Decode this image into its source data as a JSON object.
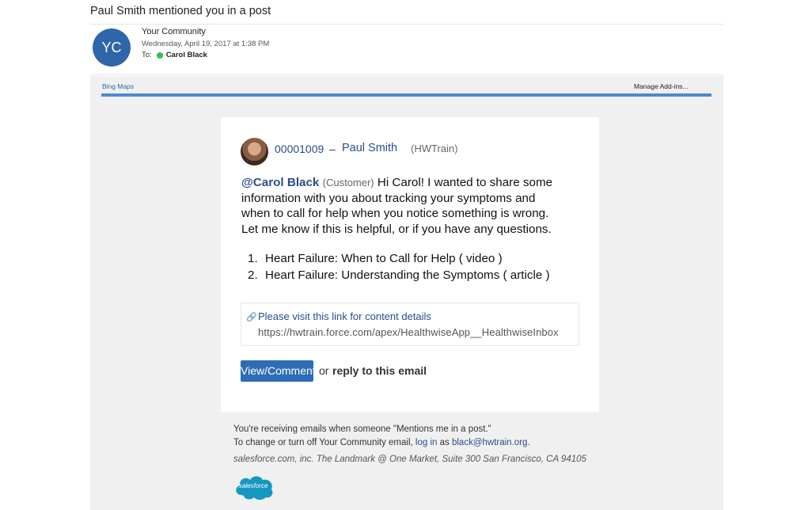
{
  "email": {
    "subject": "Paul Smith mentioned you in a post",
    "avatar_initials": "YC",
    "sender": "Your Community",
    "date": "Wednesday, April 19, 2017 at 1:38 PM",
    "to_label": "To:",
    "recipient": "Carol Black"
  },
  "addin_bar": {
    "left_link": "Bing Maps",
    "right_link": "Manage Add-ins..."
  },
  "post": {
    "case_number": "00001009",
    "separator": "–",
    "author": "Paul Smith",
    "author_org": "(HWTrain)",
    "mention": "@Carol Black",
    "mention_role": "(Customer)",
    "line1_rest": "Hi Carol! I wanted to share some",
    "line2": "information with you about tracking your symptoms and",
    "line3": "when to call for help when you notice something is wrong.",
    "line4": "Let me know if this is helpful, or if you have any questions.",
    "resources": [
      {
        "num": "1.",
        "label": "Heart Failure: When to Call for Help ( video )"
      },
      {
        "num": "2.",
        "label": "Heart Failure: Understanding the Symptoms ( article )"
      }
    ],
    "link_title": "Please visit this link for content details",
    "link_url": "https://hwtrain.force.com/apex/HealthwiseApp__HealthwiseInbox",
    "button_label": "View/Comment",
    "or_text": "or",
    "reply_text": "reply to this email"
  },
  "footer": {
    "line1": "You're receiving emails when someone \"Mentions me in a post.\"",
    "line2_prefix": "To change or turn off Your Community email,",
    "login_link": "log in",
    "as_text": "as",
    "email_link": "black@hwtrain.org",
    "period": ".",
    "address": "salesforce.com, inc. The Landmark @ One Market, Suite 300 San Francisco, CA 94105",
    "logo_text": "salesforce"
  },
  "colors": {
    "accent": "#2e6db5",
    "link": "#2a4e8c",
    "presence": "#3cba54",
    "addin_line": "#4b8bd0"
  }
}
